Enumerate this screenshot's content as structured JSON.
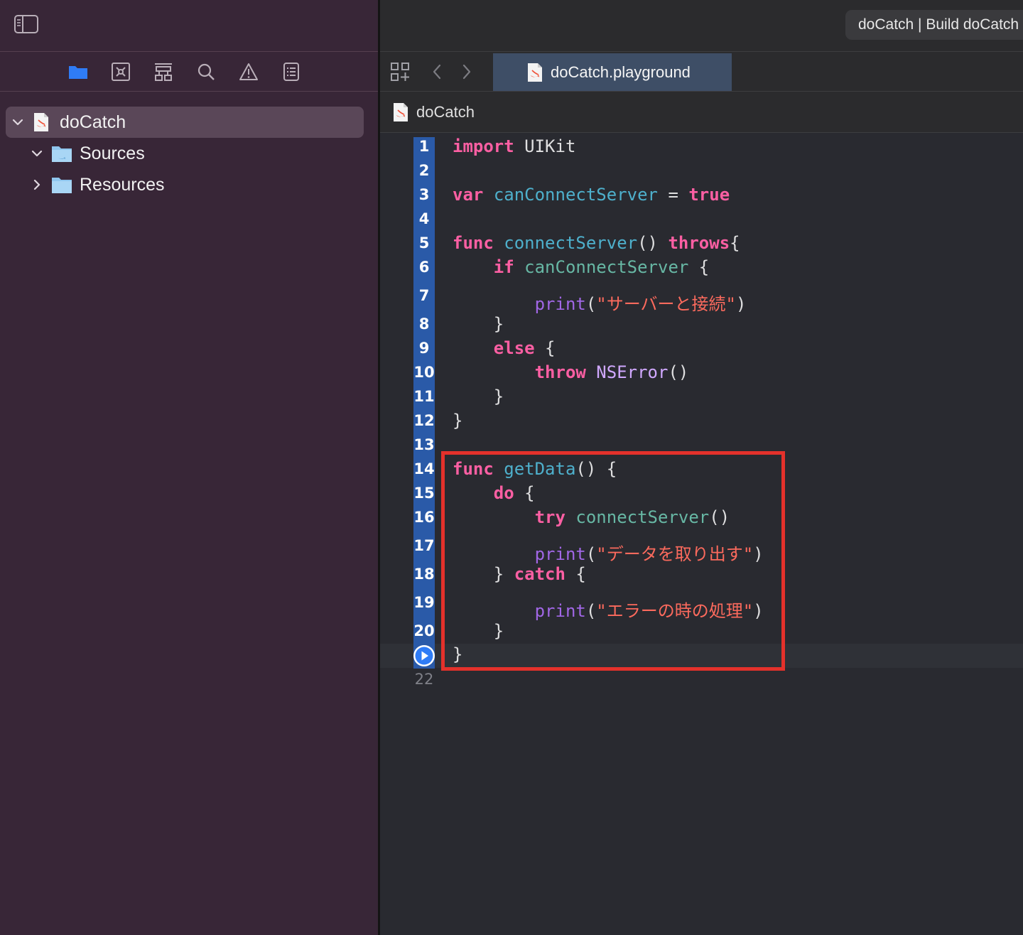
{
  "toolbar": {
    "scheme_title": "doCatch | Build doCatch"
  },
  "navigator": {
    "tabs": [
      "project-navigator",
      "source-control-navigator",
      "symbol-navigator",
      "find-navigator",
      "issue-navigator",
      "report-navigator"
    ],
    "active_tab": "project-navigator",
    "accent_color": "#2f7cf6",
    "tree": [
      {
        "label": "doCatch",
        "expanded": true,
        "selected": true
      },
      {
        "label": "Sources",
        "expanded": true,
        "selected": false
      },
      {
        "label": "Resources",
        "expanded": false,
        "selected": false
      }
    ]
  },
  "editor": {
    "tab_label": "doCatch.playground",
    "breadcrumb": "doCatch",
    "line_numbers": [
      "1",
      "2",
      "3",
      "4",
      "5",
      "6",
      "7",
      "8",
      "9",
      "10",
      "11",
      "12",
      "13",
      "14",
      "15",
      "16",
      "17",
      "18",
      "19",
      "20",
      "21",
      "22"
    ],
    "run_line": "21",
    "code_lines": [
      {
        "n": "1",
        "tokens": [
          [
            "kw",
            "import"
          ],
          [
            "plain",
            " UIKit"
          ]
        ]
      },
      {
        "n": "3",
        "tokens": [
          [
            "kw",
            "var"
          ],
          [
            "plain",
            " "
          ],
          [
            "dc",
            "canConnectServer"
          ],
          [
            "plain",
            " = "
          ],
          [
            "kw",
            "true"
          ]
        ]
      },
      {
        "n": "5",
        "tokens": [
          [
            "kw",
            "func"
          ],
          [
            "plain",
            " "
          ],
          [
            "dc",
            "connectServer"
          ],
          [
            "plain",
            "() "
          ],
          [
            "kw",
            "throws"
          ],
          [
            "plain",
            "{"
          ]
        ]
      },
      {
        "n": "6",
        "tokens": [
          [
            "plain",
            "    "
          ],
          [
            "kw",
            "if"
          ],
          [
            "plain",
            " "
          ],
          [
            "fn",
            "canConnectServer"
          ],
          [
            "plain",
            " {"
          ]
        ]
      },
      {
        "n": "7",
        "tokens": [
          [
            "plain",
            "        "
          ],
          [
            "pr",
            "print"
          ],
          [
            "plain",
            "("
          ],
          [
            "str",
            "\"サーバーと接続\""
          ],
          [
            "plain",
            ")"
          ]
        ]
      },
      {
        "n": "8",
        "tokens": [
          [
            "plain",
            "    }"
          ]
        ]
      },
      {
        "n": "9",
        "tokens": [
          [
            "plain",
            "    "
          ],
          [
            "kw",
            "else"
          ],
          [
            "plain",
            " {"
          ]
        ]
      },
      {
        "n": "10",
        "tokens": [
          [
            "plain",
            "        "
          ],
          [
            "kw",
            "throw"
          ],
          [
            "plain",
            " "
          ],
          [
            "cls",
            "NSError"
          ],
          [
            "plain",
            "()"
          ]
        ]
      },
      {
        "n": "11",
        "tokens": [
          [
            "plain",
            "    }"
          ]
        ]
      },
      {
        "n": "12",
        "tokens": [
          [
            "plain",
            "}"
          ]
        ]
      },
      {
        "n": "14",
        "tokens": [
          [
            "kw",
            "func"
          ],
          [
            "plain",
            " "
          ],
          [
            "dc",
            "getData"
          ],
          [
            "plain",
            "() {"
          ]
        ]
      },
      {
        "n": "15",
        "tokens": [
          [
            "plain",
            "    "
          ],
          [
            "kw",
            "do"
          ],
          [
            "plain",
            " {"
          ]
        ]
      },
      {
        "n": "16",
        "tokens": [
          [
            "plain",
            "        "
          ],
          [
            "kw",
            "try"
          ],
          [
            "plain",
            " "
          ],
          [
            "fn",
            "connectServer"
          ],
          [
            "plain",
            "()"
          ]
        ]
      },
      {
        "n": "17",
        "tokens": [
          [
            "plain",
            "        "
          ],
          [
            "pr",
            "print"
          ],
          [
            "plain",
            "("
          ],
          [
            "str",
            "\"データを取り出す\""
          ],
          [
            "plain",
            ")"
          ]
        ]
      },
      {
        "n": "18",
        "tokens": [
          [
            "plain",
            "    } "
          ],
          [
            "kw",
            "catch"
          ],
          [
            "plain",
            " {"
          ]
        ]
      },
      {
        "n": "19",
        "tokens": [
          [
            "plain",
            "        "
          ],
          [
            "pr",
            "print"
          ],
          [
            "plain",
            "("
          ],
          [
            "str",
            "\"エラーの時の処理\""
          ],
          [
            "plain",
            ")"
          ]
        ]
      },
      {
        "n": "20",
        "tokens": [
          [
            "plain",
            "    }"
          ]
        ]
      },
      {
        "n": "21",
        "tokens": [
          [
            "plain",
            "}"
          ]
        ]
      }
    ]
  },
  "colors": {
    "keyword": "#fc5fa3",
    "declaration": "#4eb0cc",
    "function_ref": "#67b7a4",
    "type": "#d0a8ff",
    "string": "#fc6a5d",
    "builtin_print": "#a167e6",
    "highlight_box": "#e4312b",
    "gutter": "#2a5aa8"
  }
}
